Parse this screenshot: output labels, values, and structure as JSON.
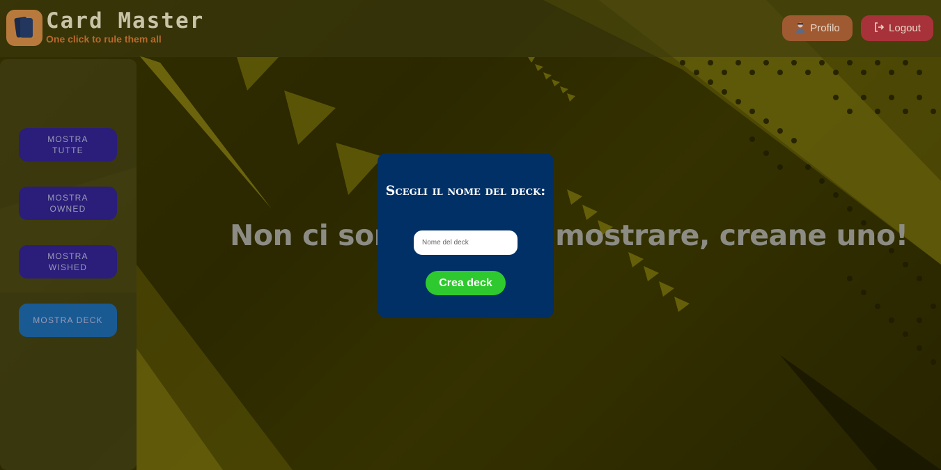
{
  "header": {
    "app_title": "Card Master",
    "app_subtitle": "One click to rule them all",
    "profile_label": "Profilo",
    "logout_label": "Logout"
  },
  "sidebar": {
    "items": [
      {
        "label": "MOSTRA TUTTE",
        "active": false
      },
      {
        "label": "MOSTRA OWNED",
        "active": false
      },
      {
        "label": "MOSTRA WISHED",
        "active": false
      },
      {
        "label": "MOSTRA DECK",
        "active": true
      }
    ]
  },
  "main": {
    "empty_message": "Non ci sono deck da mostrare, creane uno!"
  },
  "modal": {
    "title": "Scegli il nome del deck:",
    "input_placeholder": "Nome del deck",
    "input_value": "",
    "create_label": "Crea deck"
  },
  "colors": {
    "modal_bg": "#003066",
    "create_button": "#2ec92e",
    "sidebar_button": "#2a1e7a",
    "sidebar_button_active": "#1a5a92",
    "profile_button": "#a05a32",
    "logout_button": "#a8323a",
    "subtitle": "#b86a2c"
  },
  "icons": {
    "logo": "cards-icon",
    "profile": "user-avatar-icon",
    "logout": "logout-icon"
  }
}
